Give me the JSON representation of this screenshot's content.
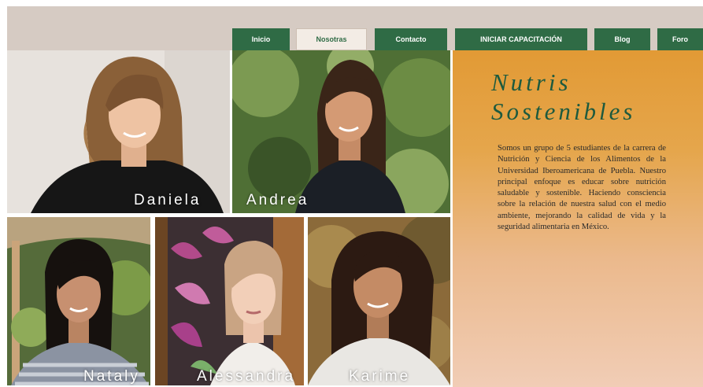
{
  "nav": {
    "items": [
      {
        "label": "Inicio"
      },
      {
        "label": "Nosotras"
      },
      {
        "label": "Contacto"
      },
      {
        "label": "INICIAR CAPACITACIÓN"
      },
      {
        "label": "Blog"
      },
      {
        "label": "Foro"
      }
    ],
    "active_index": 1
  },
  "hero": {
    "title_line1": "Nutris",
    "title_line2": "Sostenibles",
    "description": "Somos un grupo de 5 estudiantes de la carrera de Nutrición y Ciencia de los Alimentos de la Universidad Iberoamericana de Puebla. Nuestro principal enfoque es educar sobre nutrición saludable y sostenible. Haciendo consciencia sobre la relación de nuestra salud con el medio ambiente, mejorando la calidad de vida y la seguridad alimentaria en México."
  },
  "team": [
    {
      "name": "Daniela"
    },
    {
      "name": "Andrea"
    },
    {
      "name": "Nataly"
    },
    {
      "name": "Alessandra"
    },
    {
      "name": "Karime"
    }
  ],
  "colors": {
    "nav_green": "#2f6b45",
    "title_green": "#1d5a3e",
    "panel_orange": "#e29a35",
    "panel_peach": "#f1cdb6",
    "topband": "#d6cbc3"
  }
}
